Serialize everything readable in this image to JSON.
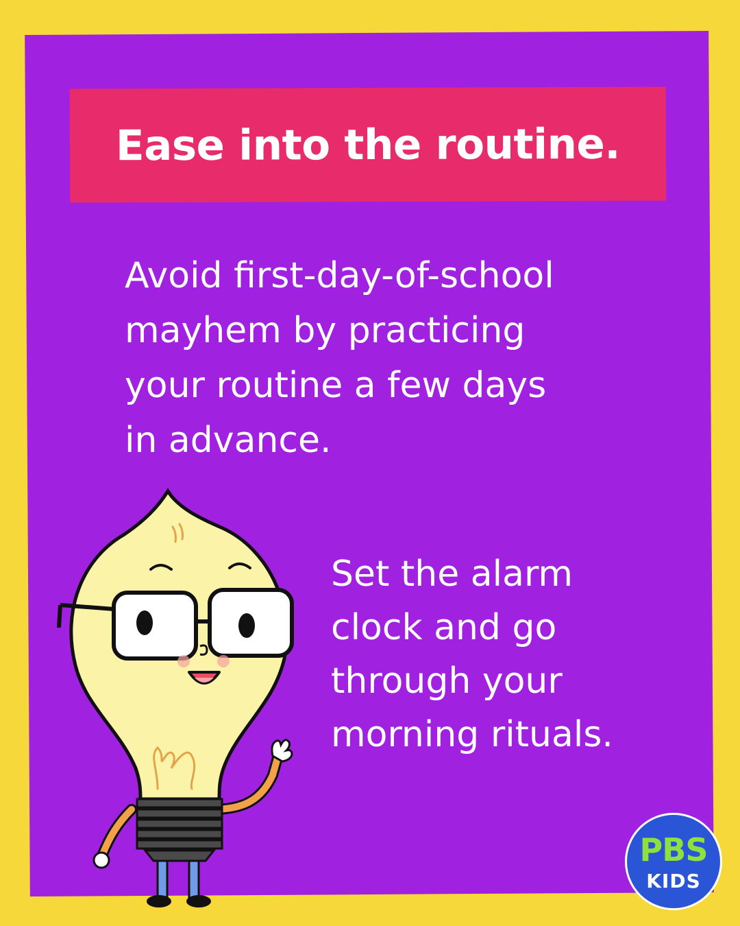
{
  "title": "Ease into the routine.",
  "intro_lines": [
    "Avoid first-day-of-school",
    "mayhem by practicing",
    "your routine a few days",
    "in advance."
  ],
  "tip_lines": [
    "Set the alarm",
    "clock and go",
    "through your",
    "morning rituals."
  ],
  "logo": {
    "top": "PBS",
    "bottom": "KIDS"
  },
  "colors": {
    "background": "#f7d83a",
    "card": "#a022e0",
    "title_banner": "#e82c6b",
    "text": "#ffffff",
    "logo_circle": "#2a55d6",
    "logo_pbs": "#8ee03c"
  },
  "mascot": "lightbulb-character-with-glasses-waving"
}
